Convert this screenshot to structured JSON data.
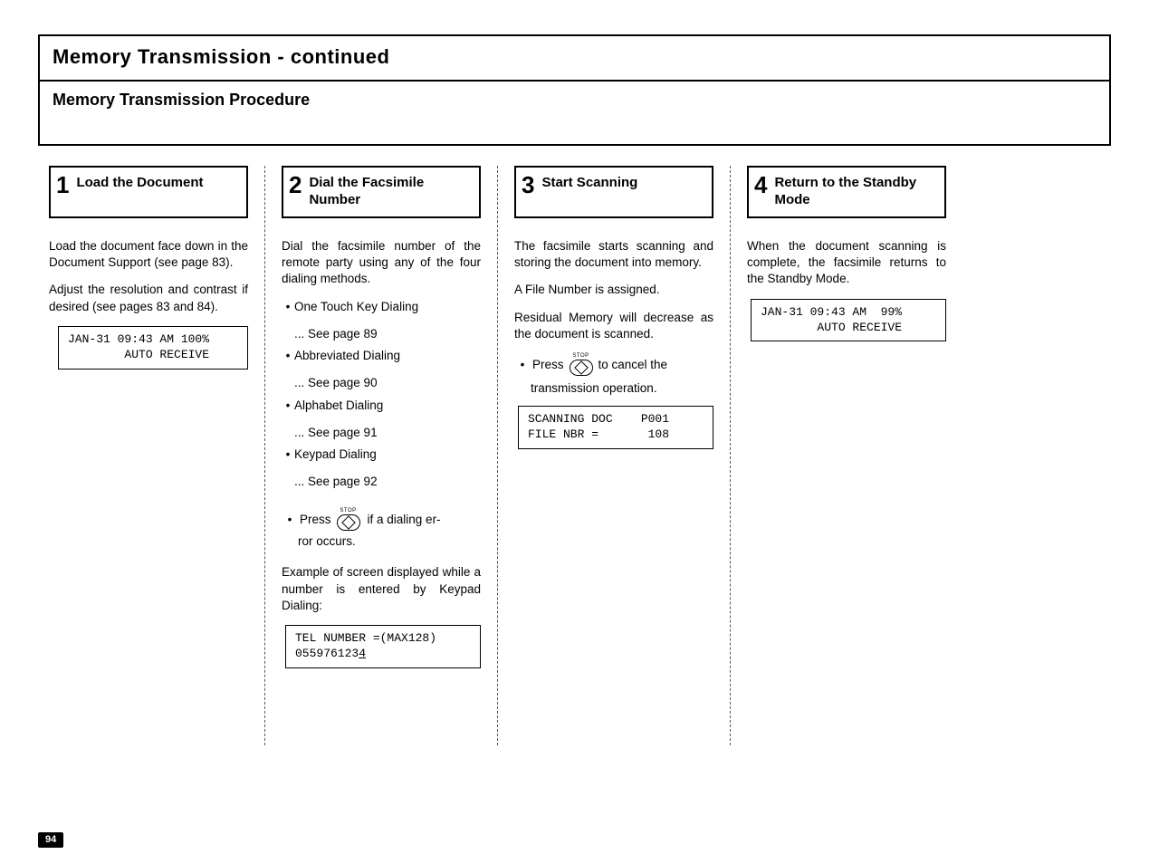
{
  "page_number": "94",
  "title": "Memory Transmission  -  continued",
  "procedure_title": "Memory Transmission Procedure",
  "steps": {
    "s1": {
      "num": "1",
      "title": "Load the Document"
    },
    "s2": {
      "num": "2",
      "title": "Dial the Facsimile Number"
    },
    "s3": {
      "num": "3",
      "title": "Start Scanning"
    },
    "s4": {
      "num": "4",
      "title": "Return to the Standby Mode"
    }
  },
  "col1": {
    "p1": "Load the document face down in the Document Support (see page 83).",
    "p2": "Adjust the resolution and contrast if desired (see pages 83 and 84).",
    "lcd": "JAN-31 09:43 AM 100%\n        AUTO RECEIVE"
  },
  "col2": {
    "p1": "Dial the facsimile number of the remote party using any of the four dialing methods.",
    "methods": {
      "m1": "One Touch Key Dialing",
      "m1s": "... See page 89",
      "m2": "Abbreviated Dialing",
      "m2s": "... See page 90",
      "m3": "Alphabet Dialing",
      "m3s": "... See page 91",
      "m4": "Keypad Dialing",
      "m4s": "... See page 92"
    },
    "press_word": "Press",
    "stop_label": "STOP",
    "press_suffix": "if a dialing error occurs.",
    "example": "Example of screen displayed while a number is entered by Keypad Dialing:",
    "lcd_l1": "TEL NUMBER =(MAX128)",
    "lcd_l2a": "055976123",
    "lcd_l2b": "4"
  },
  "col3": {
    "p1": "The facsimile starts scanning and storing the document into memory.",
    "p2": "A File Number is assigned.",
    "p3": "Residual Memory will decrease as the document is scanned.",
    "press_word": "Press",
    "stop_label": "STOP",
    "press_suffix1": "to cancel the",
    "press_suffix2": "transmission operation.",
    "lcd": "SCANNING DOC    P001\nFILE NBR =       108"
  },
  "col4": {
    "p1": "When the document scanning is complete, the facsimile returns to the Standby Mode.",
    "lcd": "JAN-31 09:43 AM  99%\n        AUTO RECEIVE"
  }
}
